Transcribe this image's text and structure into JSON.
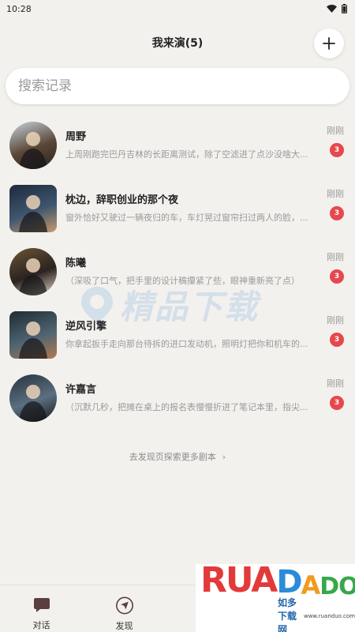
{
  "status_bar": {
    "time": "10:28"
  },
  "header": {
    "title": "我来演(5)"
  },
  "search": {
    "placeholder": "搜索记录"
  },
  "conversations": [
    {
      "name": "周野",
      "snippet": "上周刚跑完巴丹吉林的长距离测试，除了空滤进了点沙没啥大...",
      "time": "刚刚",
      "badge": "3",
      "avatar_shape": "round",
      "avatar_colors": [
        "#c7d3dc",
        "#5a4636",
        "#2c2520"
      ]
    },
    {
      "name": "枕边，辞职创业的那个夜",
      "snippet": "窗外恰好又驶过一辆夜归的车，车灯晃过窗帘扫过两人的脸，...",
      "time": "刚刚",
      "badge": "3",
      "avatar_shape": "square",
      "avatar_colors": [
        "#1c2a3a",
        "#3f5670",
        "#c89a6a"
      ]
    },
    {
      "name": "陈曦",
      "snippet": "（深吸了口气，把手里的设计稿攥紧了些，眼神重新亮了点）",
      "time": "刚刚",
      "badge": "3",
      "avatar_shape": "round",
      "avatar_colors": [
        "#6b5636",
        "#2a2320",
        "#e7d9c4"
      ]
    },
    {
      "name": "逆风引擎",
      "snippet": "你拿起扳手走向那台待拆的进口发动机，照明灯把你和机车的...",
      "time": "刚刚",
      "badge": "3",
      "avatar_shape": "square",
      "avatar_colors": [
        "#1f2b33",
        "#4e6470",
        "#b07a52"
      ]
    },
    {
      "name": "许嘉言",
      "snippet": "（沉默几秒，把摊在桌上的报名表慢慢折进了笔记本里，指尖...",
      "time": "刚刚",
      "badge": "3",
      "avatar_shape": "round",
      "avatar_colors": [
        "#27323d",
        "#5a6f80",
        "#1a1a1a"
      ]
    }
  ],
  "more_link": {
    "label": "去发现页探索更多剧本",
    "arrow": "›"
  },
  "watermark": {
    "text": "精品下载"
  },
  "tabs": [
    {
      "label": "对话",
      "icon": "chat-icon"
    },
    {
      "label": "发现",
      "icon": "compass-icon"
    }
  ],
  "brand_logo": {
    "text": "RUANDADO",
    "cn": "如多下载网",
    "url": "www.ruanduo.com"
  },
  "colors": {
    "badge": "#e5484d",
    "background": "#f3f1ee",
    "icon_brown": "#5b3f3f"
  }
}
